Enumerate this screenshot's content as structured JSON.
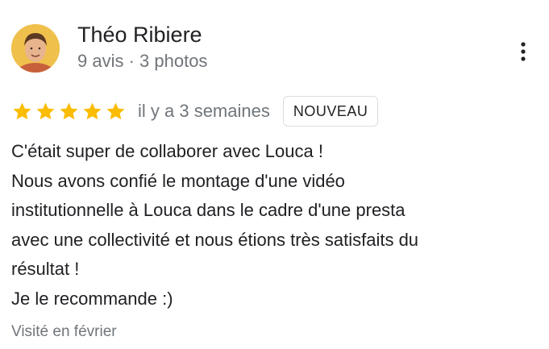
{
  "reviewer": {
    "name": "Théo Ribiere",
    "meta": "9 avis · 3 photos"
  },
  "review": {
    "stars": 5,
    "max_stars": 5,
    "star_color": "#fbbc04",
    "date": "il y a 3 semaines",
    "badge": "NOUVEAU",
    "text": "C'était super de collaborer avec Louca !\nNous avons confié le montage d'une vidéo\ninstitutionnelle à Louca dans le cadre d'une presta\navec une collectivité et nous étions très satisfaits du\nrésultat !\nJe le recommande :)",
    "visited": "Visité en février"
  },
  "icons": {
    "more": "more-vert-icon",
    "star": "star-icon"
  }
}
